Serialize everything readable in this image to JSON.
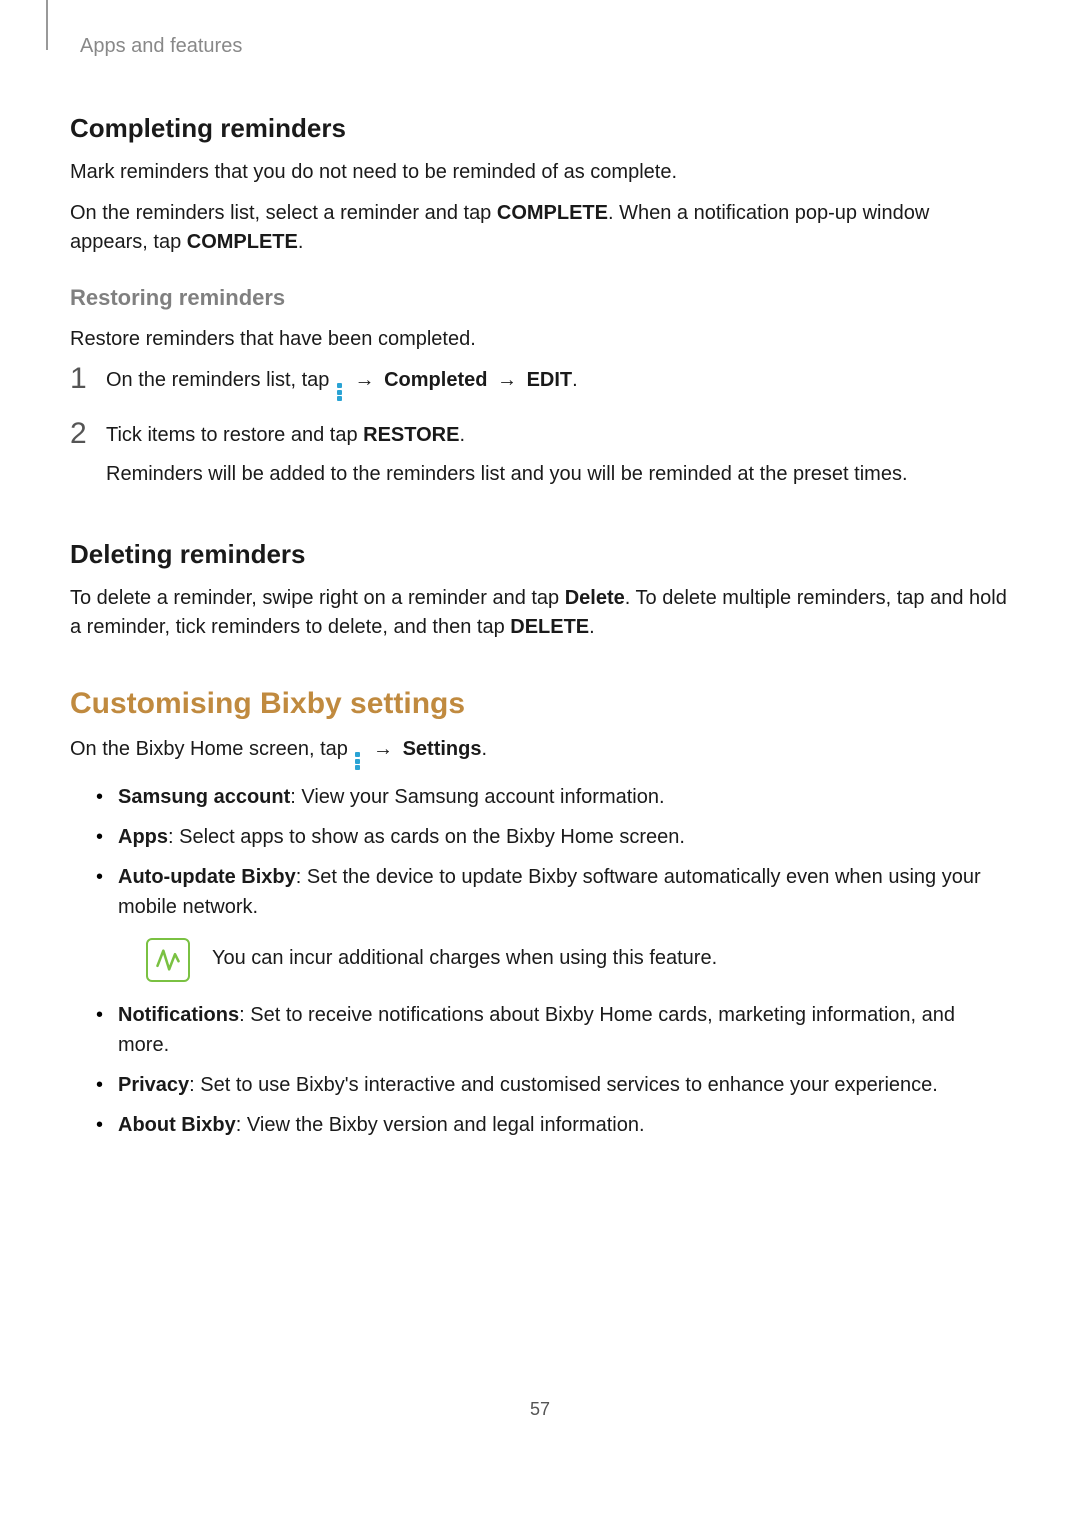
{
  "header": "Apps and features",
  "page_number": "57",
  "section1": {
    "title": "Completing reminders",
    "p1": "Mark reminders that you do not need to be reminded of as complete.",
    "p2_a": "On the reminders list, select a reminder and tap ",
    "p2_b": "COMPLETE",
    "p2_c": ". When a notification pop-up window appears, tap ",
    "p2_d": "COMPLETE",
    "p2_e": "."
  },
  "section2": {
    "title": "Restoring reminders",
    "p1": "Restore reminders that have been completed.",
    "step1_num": "1",
    "step1_a": "On the reminders list, tap ",
    "step1_b": "Completed",
    "step1_c": "EDIT",
    "arrow": "→",
    "step2_num": "2",
    "step2_a": "Tick items to restore and tap ",
    "step2_b": "RESTORE",
    "step2_c": ".",
    "step2_p2": "Reminders will be added to the reminders list and you will be reminded at the preset times."
  },
  "section3": {
    "title": "Deleting reminders",
    "p1_a": "To delete a reminder, swipe right on a reminder and tap ",
    "p1_b": "Delete",
    "p1_c": ". To delete multiple reminders, tap and hold a reminder, tick reminders to delete, and then tap ",
    "p1_d": "DELETE",
    "p1_e": "."
  },
  "section4": {
    "title": "Customising Bixby settings",
    "intro_a": "On the Bixby Home screen, tap ",
    "intro_b": "Settings",
    "intro_c": ".",
    "arrow": "→",
    "items": [
      {
        "label": "Samsung account",
        "desc": ": View your Samsung account information."
      },
      {
        "label": "Apps",
        "desc": ": Select apps to show as cards on the Bixby Home screen."
      },
      {
        "label": "Auto-update Bixby",
        "desc": ": Set the device to update Bixby software automatically even when using your mobile network."
      }
    ],
    "note": "You can incur additional charges when using this feature.",
    "items2": [
      {
        "label": "Notifications",
        "desc": ": Set to receive notifications about Bixby Home cards, marketing information, and more."
      },
      {
        "label": "Privacy",
        "desc": ": Set to use Bixby's interactive and customised services to enhance your experience."
      },
      {
        "label": "About Bixby",
        "desc": ": View the Bixby version and legal information."
      }
    ]
  }
}
